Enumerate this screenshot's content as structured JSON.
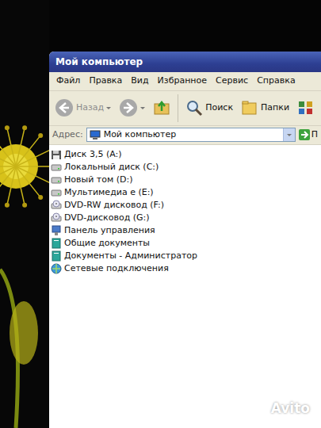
{
  "window": {
    "title": "Мой компьютер"
  },
  "menu": [
    "Файл",
    "Правка",
    "Вид",
    "Избранное",
    "Сервис",
    "Справка"
  ],
  "toolbar": {
    "back": {
      "label": "Назад",
      "disabled": true
    },
    "forward": {
      "disabled": true
    },
    "search": "Поиск",
    "folders": "Папки"
  },
  "address": {
    "label": "Адрес:",
    "value": "Мой компьютер",
    "go": "П"
  },
  "items": [
    {
      "label": "Диск 3,5 (A:)",
      "kind": "floppy"
    },
    {
      "label": "Локальный диск (C:)",
      "kind": "drive"
    },
    {
      "label": "Новый том (D:)",
      "kind": "drive"
    },
    {
      "label": "Мультимедиа е (E:)",
      "kind": "drive"
    },
    {
      "label": "DVD-RW дисковод (F:)",
      "kind": "cd"
    },
    {
      "label": "DVD-дисковод (G:)",
      "kind": "cd"
    },
    {
      "label": "Панель управления",
      "kind": "panel"
    },
    {
      "label": "Общие документы",
      "kind": "folder"
    },
    {
      "label": "Документы - Администратор",
      "kind": "folder"
    },
    {
      "label": "Сетевые подключения",
      "kind": "network"
    }
  ],
  "watermark": "Avito"
}
